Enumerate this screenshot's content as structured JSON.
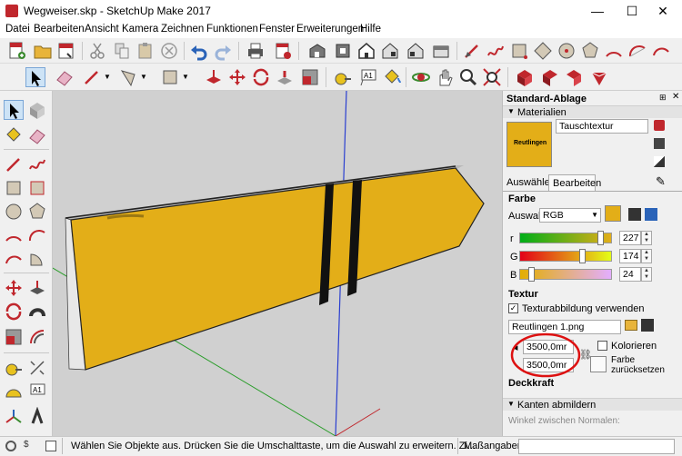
{
  "window": {
    "title": "Wegweiser.skp - SketchUp Make 2017",
    "minimize": "—",
    "maximize": "☐",
    "close": "✕"
  },
  "menu": [
    "Datei",
    "Bearbeiten",
    "Ansicht",
    "Kamera",
    "Zeichnen",
    "Funktionen",
    "Fenster",
    "Erweiterungen",
    "Hilfe"
  ],
  "tray": {
    "title": "Standard-Ablage",
    "panel": "Materialien",
    "material_name": "Tauschtextur",
    "swatch_text": "Reutlingen",
    "tabs": [
      "Auswählen",
      "Bearbeiten"
    ],
    "farbe": {
      "heading": "Farbe",
      "auswahl_label": "Auswahl:",
      "mode": "RGB",
      "r_label": "r",
      "r_value": "227",
      "g_label": "G",
      "g_value": "174",
      "b_label": "B",
      "b_value": "24",
      "r_frac": 0.89,
      "g_frac": 0.68,
      "b_frac": 0.09
    },
    "textur": {
      "heading": "Textur",
      "checkbox_label": "Texturabbildung verwenden",
      "file": "Reutlingen 1.png",
      "width": "3500,0mr",
      "height": "3500,0mr",
      "colorize_label": "Kolorieren",
      "reset_label": "Farbe zurücksetzen"
    },
    "deckkraft": "Deckkraft",
    "kanten": "Kanten abmildern",
    "winkel": "Winkel zwischen Normalen:"
  },
  "status": {
    "text": "Wählen Sie Objekte aus. Drücken Sie die Umschalttaste, um die Auswahl zu erweitern. Zi...",
    "measure": "Maßangaben"
  },
  "colors": {
    "material": "#e3ae18",
    "accent": "#c0272d"
  }
}
